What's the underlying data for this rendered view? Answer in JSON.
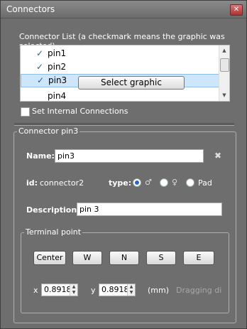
{
  "window": {
    "title": "Connectors",
    "close_glyph": "✕"
  },
  "list": {
    "caption": "Connector List (a checkmark means the graphic was selected)",
    "items": [
      {
        "label": "pin1",
        "checked": "✓"
      },
      {
        "label": "pin2",
        "checked": "✓"
      },
      {
        "label": "pin3",
        "checked": "✓",
        "button": "Select graphic"
      },
      {
        "label": "pin4"
      }
    ]
  },
  "internal": {
    "label": "Set Internal Connections"
  },
  "connector": {
    "group_title": "Connector pin3",
    "name_label": "Name:",
    "name_value": "pin3",
    "id_label": "id:",
    "id_value": "connector2",
    "type_label": "type:",
    "type_options": [
      "♂",
      "♀",
      "Pad"
    ],
    "type_selected": 0,
    "description_label": "Description:",
    "description_value": "pin 3"
  },
  "terminal": {
    "group_title": "Terminal point",
    "buttons": [
      "Center",
      "W",
      "N",
      "S",
      "E"
    ],
    "x_label": "x",
    "x_value": "0.8918",
    "y_label": "y",
    "y_value": "0.8918",
    "unit": "(mm)",
    "hint": "Dragging di"
  }
}
